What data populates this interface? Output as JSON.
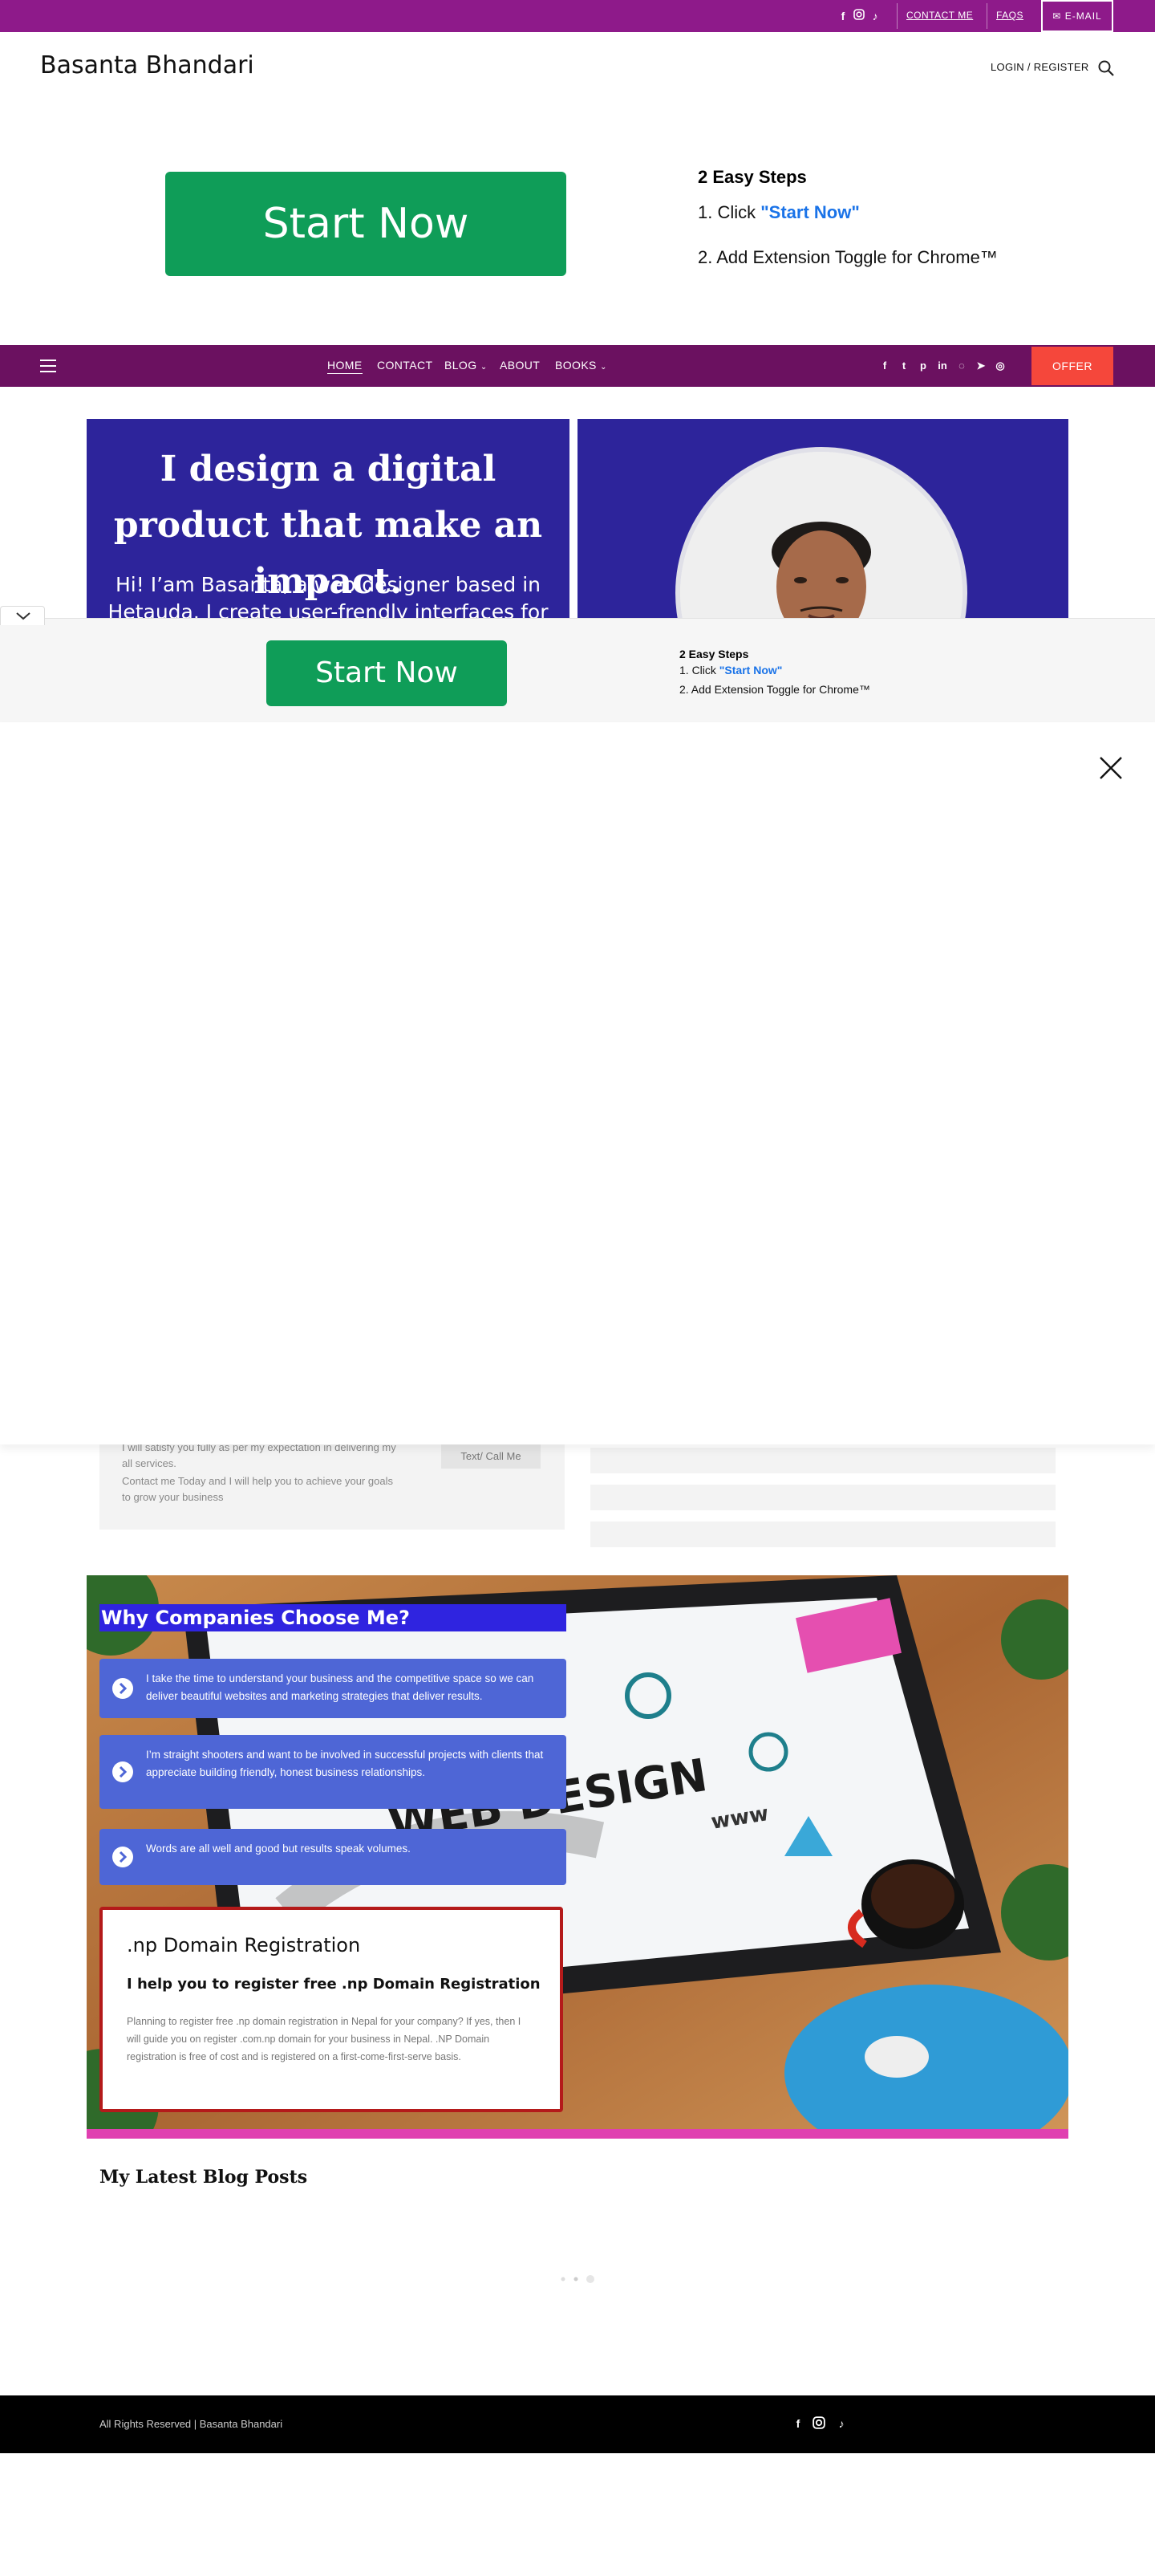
{
  "topbar": {
    "social": [
      "facebook-icon",
      "instagram-icon",
      "tiktok-icon"
    ],
    "contact_label": "CONTACT ME",
    "faqs_label": "FAQS",
    "email_label": "E-MAIL"
  },
  "header": {
    "site_title": "Basanta Bhandari",
    "login_label": "LOGIN / REGISTER"
  },
  "ad_top": {
    "button_label": "Start Now",
    "steps_title": "2 Easy Steps",
    "step1_prefix": "1. Click ",
    "step1_highlight": "\"Start Now\"",
    "step2": "2. Add Extension Toggle for Chrome™"
  },
  "nav": {
    "items": [
      "HOME",
      "CONTACT",
      "BLOG",
      "ABOUT",
      "BOOKS"
    ],
    "dropdown_marker": "⌄",
    "offer_label": "OFFER",
    "social": [
      "facebook-icon",
      "twitter-icon",
      "pinterest-icon",
      "linkedin-icon",
      "whatsapp-icon",
      "telegram-icon",
      "viber-icon"
    ]
  },
  "hero": {
    "heading": "I design a digital product that make an impact.",
    "subtitle": "Hi! I’am Basanta, a web designer based in Hetauda. I create user-frendly interfaces for fast"
  },
  "sticky_ad": {
    "button_label": "Start Now",
    "steps_title": "2 Easy Steps",
    "step1_prefix": "1. Click ",
    "step1_highlight": "\"Start Now\"",
    "step2": "2. Add Extension Toggle for Chrome™"
  },
  "contact_card": {
    "line1": "I will satisfy you fully as per my expectation in delivering my",
    "line2": "all services.",
    "line3": "Contact me Today and I will help you to achieve your goals",
    "line4": "to grow your business",
    "button_label": "Text/ Call Me"
  },
  "why": {
    "title": "Why Companies Choose Me?",
    "items": [
      "I take the time to understand your business and the competitive space so we can deliver beautiful websites and marketing strategies that deliver results.",
      "I’m straight shooters and want to be involved in successful projects with clients that appreciate building friendly, honest business relationships.",
      "Words are all well and good but results speak volumes."
    ],
    "image_text_1": "WEB DESIGN",
    "image_text_2": "www"
  },
  "domain": {
    "title": ".np Domain Registration",
    "subtitle": "I help you to register free .np Domain Registration",
    "body": "Planning to register free .np domain registration in Nepal for your company? If yes, then I will guide you on register .com.np domain for your business in Nepal. .NP Domain registration is free of cost and is registered on a first-come-first-serve basis."
  },
  "blog": {
    "title": "My Latest Blog Posts"
  },
  "footer": {
    "copyright": "All Rights Reserved | Basanta Bhandari",
    "social": [
      "facebook-icon",
      "instagram-icon",
      "tiktok-icon"
    ]
  },
  "colors": {
    "topbar": "#8e1a8a",
    "nav": "#6b1160",
    "hero_bg": "#2d249b",
    "start_button": "#0f9d58",
    "offer_button": "#f5473b",
    "why_item": "#4e66d6",
    "why_title": "#2f24e0",
    "domain_border": "#b41a1a"
  }
}
